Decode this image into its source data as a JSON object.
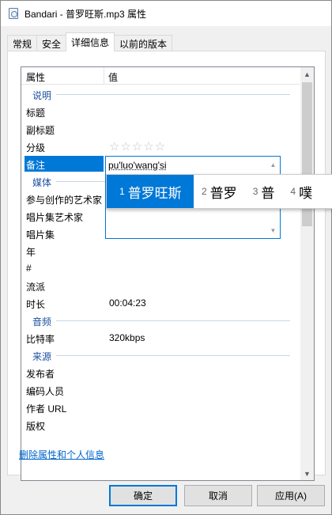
{
  "window": {
    "title": "Bandari - 普罗旺斯.mp3 属性"
  },
  "tabs": [
    {
      "label": "常规"
    },
    {
      "label": "安全"
    },
    {
      "label": "详细信息"
    },
    {
      "label": "以前的版本"
    }
  ],
  "list": {
    "header": {
      "property": "属性",
      "value": "值"
    },
    "groups": {
      "description": "说明",
      "media": "媒体",
      "audio": "音频",
      "origin": "来源"
    },
    "rows": {
      "title": "标题",
      "subtitle": "副标题",
      "rating": "分级",
      "comments": "备注",
      "contributing_artists": "参与创作的艺术家",
      "album_artist": "唱片集艺术家",
      "album": "唱片集",
      "year": "年",
      "track": "#",
      "genre": "流派",
      "length": "时长",
      "length_value": "00:04:23",
      "bitrate": "比特率",
      "bitrate_value": "320kbps",
      "publisher": "发布者",
      "encoded_by": "编码人员",
      "author_url": "作者 URL",
      "copyright": "版权"
    },
    "rating_stars": "☆☆☆☆☆"
  },
  "editor": {
    "value": "pu'luo'wang'si"
  },
  "ime": {
    "candidates": [
      {
        "num": "1",
        "word": "普罗旺斯"
      },
      {
        "num": "2",
        "word": "普罗"
      },
      {
        "num": "3",
        "word": "普"
      },
      {
        "num": "4",
        "word": "噗"
      }
    ]
  },
  "remove_link": "删除属性和个人信息",
  "buttons": {
    "ok": "确定",
    "cancel": "取消",
    "apply": "应用(A)"
  },
  "colors": {
    "accent": "#0078d7",
    "group_text": "#1e50a0",
    "link": "#0066cc"
  }
}
